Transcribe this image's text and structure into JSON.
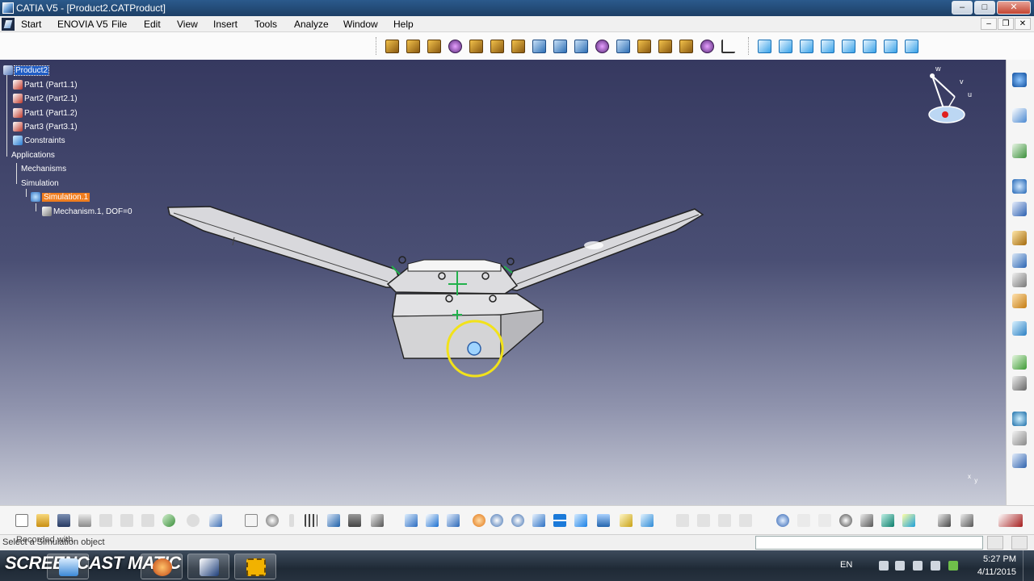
{
  "window": {
    "title": "CATIA V5 - [Product2.CATProduct]",
    "controls": {
      "minimize": "–",
      "maximize": "□",
      "close": "✕"
    }
  },
  "menubar": {
    "items": [
      "Start",
      "ENOVIA V5",
      "File",
      "Edit",
      "View",
      "Insert",
      "Tools",
      "Analyze",
      "Window",
      "Help"
    ],
    "mdi_controls": {
      "minimize": "–",
      "restore": "❐",
      "close": "✕"
    }
  },
  "tree": {
    "root": "Product2",
    "nodes": [
      {
        "label": "Part1 (Part1.1)"
      },
      {
        "label": "Part2 (Part2.1)"
      },
      {
        "label": "Part1 (Part1.2)"
      },
      {
        "label": "Part3 (Part3.1)"
      },
      {
        "label": "Constraints"
      },
      {
        "label": "Applications"
      },
      {
        "label": "Mechanisms"
      },
      {
        "label": "Simulation"
      },
      {
        "label": "Simulation.1"
      },
      {
        "label": "Mechanism.1, DOF=0"
      }
    ]
  },
  "compass": {
    "axes": [
      "w",
      "v",
      "u"
    ]
  },
  "axis_mini": {
    "x": "x",
    "y": "y"
  },
  "status": {
    "message": "Select a Simulation object",
    "watermark": "Recorded with"
  },
  "screencast_logo": "SCREENCAST  MATIC",
  "taskbar": {
    "language": "EN",
    "time": "5:27 PM",
    "date": "4/11/2015"
  },
  "colors": {
    "viewport_top": "#363960",
    "viewport_bottom": "#c9ccd8",
    "tree_selection": "#1f5cc4",
    "simulation_highlight": "#f07d1e",
    "cursor_ring": "#f2e21a"
  }
}
